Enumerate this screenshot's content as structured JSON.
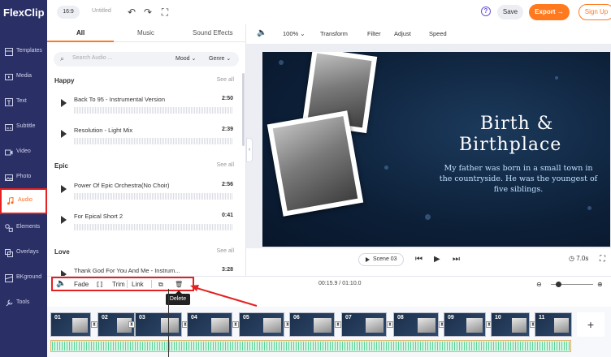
{
  "app": {
    "logo": "FlexClip",
    "aspect_ratio": "16:9",
    "doc_title": "Untitled"
  },
  "sidebar": {
    "items": [
      {
        "label": "Templates",
        "icon": "templates-icon"
      },
      {
        "label": "Media",
        "icon": "media-icon"
      },
      {
        "label": "Text",
        "icon": "text-icon"
      },
      {
        "label": "Subtitle",
        "icon": "subtitle-icon"
      },
      {
        "label": "Video",
        "icon": "video-icon"
      },
      {
        "label": "Photo",
        "icon": "photo-icon"
      },
      {
        "label": "Audio",
        "icon": "audio-icon",
        "active": true
      },
      {
        "label": "Elements",
        "icon": "elements-icon"
      },
      {
        "label": "Overlays",
        "icon": "overlays-icon"
      },
      {
        "label": "BKground",
        "icon": "background-icon"
      },
      {
        "label": "Tools",
        "icon": "tools-icon"
      }
    ]
  },
  "header": {
    "save_label": "Save",
    "export_label": "Export",
    "signup_label": "Sign Up"
  },
  "audio_panel": {
    "tabs": [
      "All",
      "Music",
      "Sound Effects"
    ],
    "search_placeholder": "Search Audio ...",
    "mood_label": "Mood",
    "genre_label": "Genre",
    "see_all": "See all",
    "categories": [
      {
        "name": "Happy",
        "tracks": [
          {
            "name": "Back To 95 - Instrumental Version",
            "duration": "2:50"
          },
          {
            "name": "Resolution - Light Mix",
            "duration": "2:39"
          }
        ]
      },
      {
        "name": "Epic",
        "tracks": [
          {
            "name": "Power Of Epic Orchestra(No Choir)",
            "duration": "2:56"
          },
          {
            "name": "For Epical Short 2",
            "duration": "0:41"
          }
        ]
      },
      {
        "name": "Love",
        "tracks": [
          {
            "name": "Thank God For You And Me - Instrum...",
            "duration": "3:28"
          }
        ]
      }
    ]
  },
  "preview_toolbar": {
    "zoom": "100%",
    "transform": "Transform",
    "filter": "Filter",
    "adjust": "Adjust",
    "speed": "Speed"
  },
  "canvas": {
    "title_line1": "Birth &",
    "title_line2": "Birthplace",
    "subtext": "My father was born in a small town in the countryside. He was the youngest of five siblings."
  },
  "playback": {
    "scene_label": "Scene 03",
    "scene_duration": "7.0s"
  },
  "timeline": {
    "fade_label": "Fade",
    "trim_label": "Trim",
    "link_label": "Link",
    "timecode": "00:15.9 / 01:10.0",
    "tooltip": "Delete",
    "clips": [
      "01",
      "02",
      "03",
      "04",
      "05",
      "06",
      "07",
      "08",
      "09",
      "10",
      "11"
    ]
  },
  "colors": {
    "accent": "#ff7a1f",
    "sidebar_bg": "#2a2f66",
    "highlight_red": "#e52020",
    "audio_wave": "#5fd39a"
  }
}
